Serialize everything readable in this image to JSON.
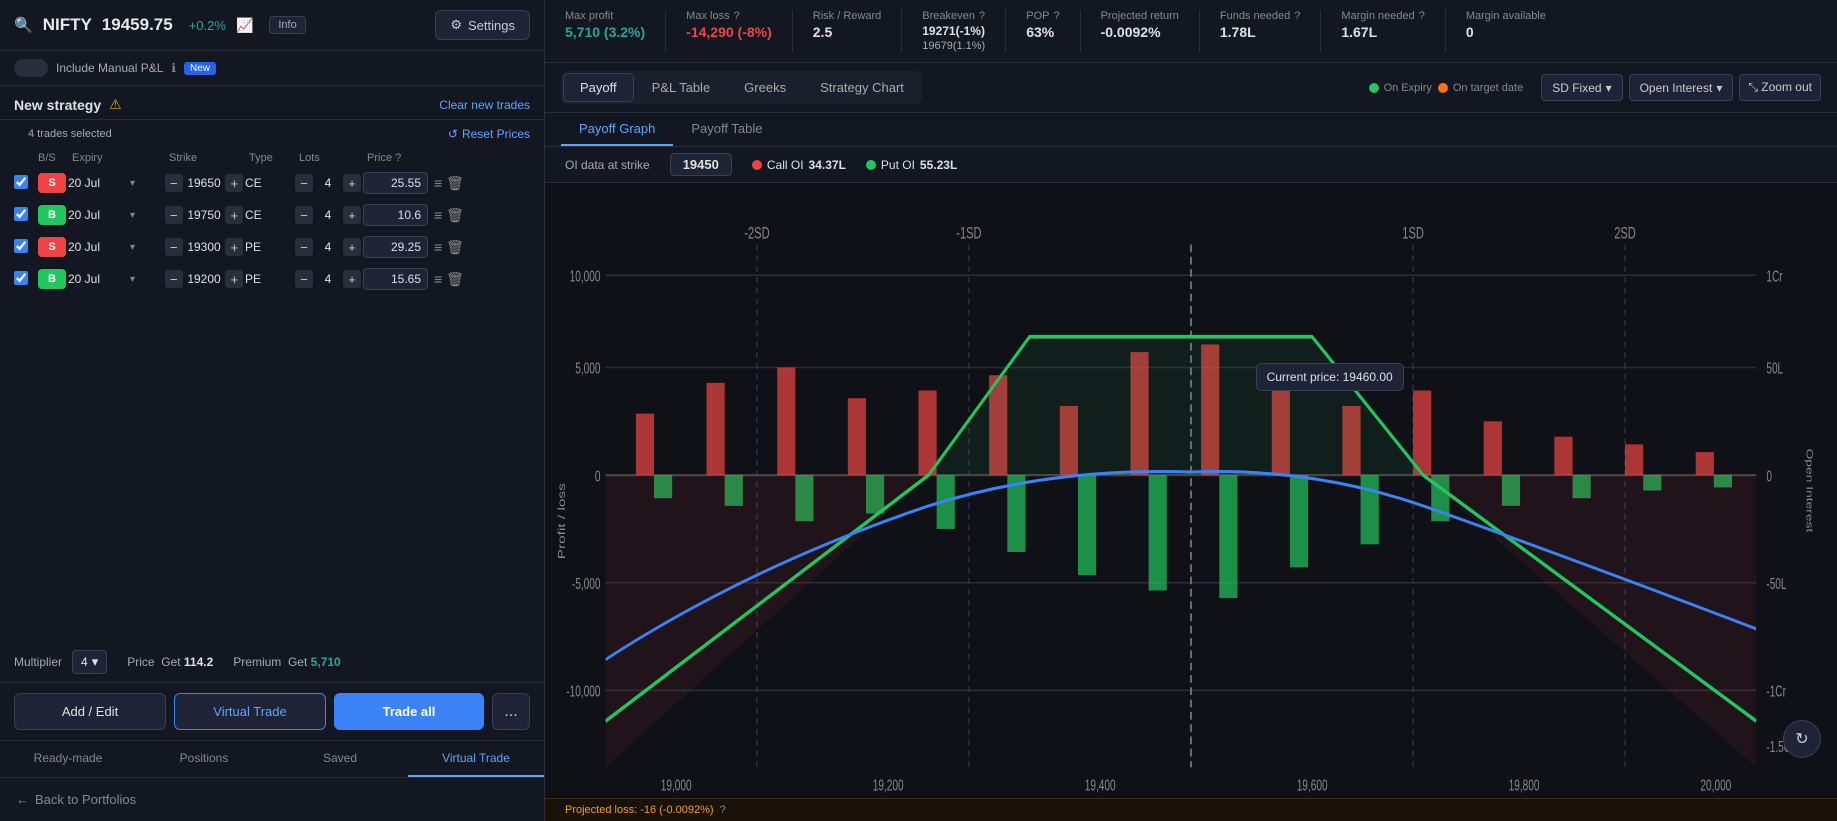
{
  "ticker": {
    "symbol": "NIFTY",
    "price": "19459.75",
    "change": "+0.2%",
    "info_label": "Info"
  },
  "settings": {
    "label": "Settings"
  },
  "manual_pnl": {
    "label": "Include Manual P&L",
    "new_badge": "New"
  },
  "strategy": {
    "title": "New strategy",
    "warning": "⚠",
    "clear_label": "Clear new trades",
    "reset_label": "Reset Prices",
    "trade_count": "4 trades selected"
  },
  "table_headers": {
    "bs": "B/S",
    "expiry": "Expiry",
    "strike": "Strike",
    "type": "Type",
    "lots": "Lots",
    "price": "Price"
  },
  "trades": [
    {
      "id": 1,
      "bs": "S",
      "bs_type": "sell",
      "expiry": "20 Jul",
      "strike": "19650",
      "type": "CE",
      "lots": "4",
      "price": "25.55"
    },
    {
      "id": 2,
      "bs": "B",
      "bs_type": "buy",
      "expiry": "20 Jul",
      "strike": "19750",
      "type": "CE",
      "lots": "4",
      "price": "10.6"
    },
    {
      "id": 3,
      "bs": "S",
      "bs_type": "sell",
      "expiry": "20 Jul",
      "strike": "19300",
      "type": "PE",
      "lots": "4",
      "price": "29.25"
    },
    {
      "id": 4,
      "bs": "B",
      "bs_type": "buy",
      "expiry": "20 Jul",
      "strike": "19200",
      "type": "PE",
      "lots": "4",
      "price": "15.65"
    }
  ],
  "multiplier": {
    "label": "Multiplier",
    "value": "4"
  },
  "price_get": {
    "label": "Price  Get",
    "value": "114.2"
  },
  "premium_get": {
    "label": "Premium  Get",
    "value": "5,710"
  },
  "action_buttons": {
    "add_edit": "Add / Edit",
    "virtual_trade": "Virtual Trade",
    "trade_all": "Trade all",
    "more": "..."
  },
  "bottom_tabs": [
    {
      "id": "ready-made",
      "label": "Ready-made"
    },
    {
      "id": "positions",
      "label": "Positions"
    },
    {
      "id": "saved",
      "label": "Saved"
    },
    {
      "id": "virtual-trade",
      "label": "Virtual Trade",
      "active": true
    }
  ],
  "back_btn": "Back to Portfolios",
  "stats": {
    "max_profit": {
      "label": "Max profit",
      "value": "5,710 (3.2%)",
      "color": "green"
    },
    "max_loss": {
      "label": "Max loss",
      "value": "-14,290 (-8%)",
      "color": "red"
    },
    "risk_reward": {
      "label": "Risk / Reward",
      "value": "2.5",
      "color": "white"
    },
    "breakeven": {
      "label": "Breakeven",
      "value1": "19271(-1%)",
      "value2": "19679(1.1%)",
      "color": "white"
    },
    "pop": {
      "label": "POP",
      "value": "63%",
      "color": "white"
    },
    "projected_return": {
      "label": "Projected return",
      "value": "-0.0092%",
      "color": "white"
    },
    "funds_needed": {
      "label": "Funds needed",
      "value": "1.78L",
      "color": "white"
    },
    "margin_needed": {
      "label": "Margin needed",
      "value": "1.67L",
      "color": "white"
    },
    "margin_available": {
      "label": "Margin available",
      "value": "0",
      "color": "white"
    }
  },
  "chart_toolbar": {
    "tabs": [
      "Payoff",
      "P&L Table",
      "Greeks",
      "Strategy Chart"
    ],
    "active_tab": "Payoff",
    "legend": [
      {
        "label": "On Expiry",
        "color": "green"
      },
      {
        "label": "On target date",
        "color": "orange"
      }
    ],
    "sd_label": "SD Fixed",
    "open_interest_label": "Open Interest",
    "zoom_label": "Zoom out"
  },
  "chart_subtabs": {
    "payoff_graph": "Payoff Graph",
    "payoff_table": "Payoff Table",
    "active": "Payoff Graph"
  },
  "oi_bar": {
    "label": "OI data at strike",
    "strike": "19450",
    "call_label": "Call OI",
    "call_value": "34.37L",
    "put_label": "Put OI",
    "put_value": "55.23L"
  },
  "chart_tooltip": {
    "text": "Current price: 19460.00"
  },
  "projected_loss": {
    "text": "Projected loss: -16 (-0.0092%)"
  },
  "x_axis": [
    "19,000",
    "19,200",
    "19,400",
    "19,600",
    "19,800",
    "20,000"
  ],
  "y_axis_left": [
    "10,000",
    "5,000",
    "0",
    "-5,000",
    "-10,000"
  ],
  "y_axis_right": [
    "1Cr",
    "50L",
    "0",
    "-50L",
    "-1Cr",
    "-1.5Cr"
  ],
  "sd_labels": [
    "-2SD",
    "-1SD",
    "1SD",
    "2SD"
  ]
}
